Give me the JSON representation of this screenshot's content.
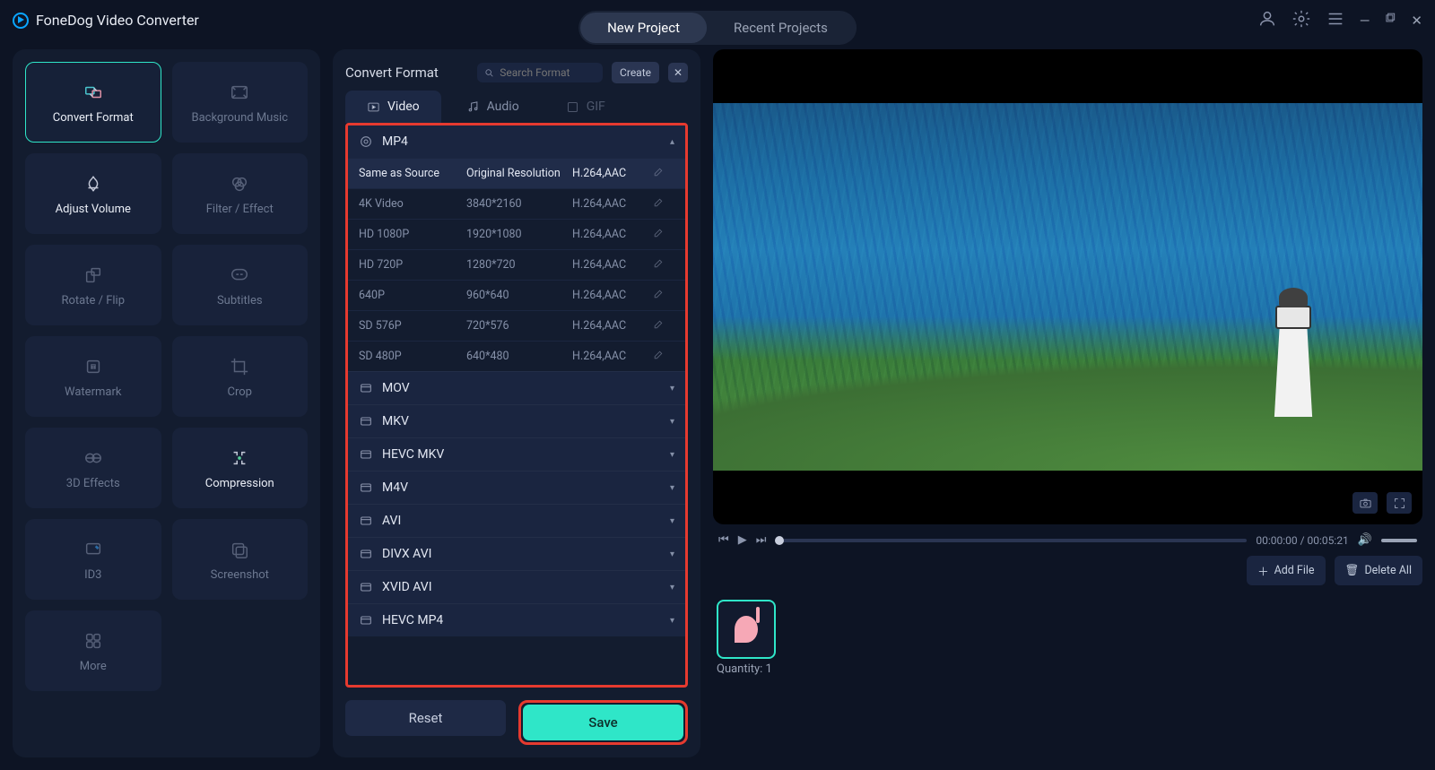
{
  "app_title": "FoneDog Video Converter",
  "tabs": {
    "new": "New Project",
    "recent": "Recent Projects"
  },
  "sidebar": {
    "tools": [
      {
        "id": "convert-format",
        "label": "Convert Format",
        "icon": "convert"
      },
      {
        "id": "background-music",
        "label": "Background Music",
        "icon": "music"
      },
      {
        "id": "adjust-volume",
        "label": "Adjust Volume",
        "icon": "volume"
      },
      {
        "id": "filter-effect",
        "label": "Filter / Effect",
        "icon": "filter"
      },
      {
        "id": "rotate-flip",
        "label": "Rotate / Flip",
        "icon": "rotate"
      },
      {
        "id": "subtitles",
        "label": "Subtitles",
        "icon": "subtitles"
      },
      {
        "id": "watermark",
        "label": "Watermark",
        "icon": "watermark"
      },
      {
        "id": "crop",
        "label": "Crop",
        "icon": "crop"
      },
      {
        "id": "3d-effects",
        "label": "3D Effects",
        "icon": "3d"
      },
      {
        "id": "compression",
        "label": "Compression",
        "icon": "compress"
      },
      {
        "id": "id3",
        "label": "ID3",
        "icon": "id3"
      },
      {
        "id": "screenshot",
        "label": "Screenshot",
        "icon": "screenshot"
      },
      {
        "id": "more",
        "label": "More",
        "icon": "more"
      }
    ]
  },
  "mid": {
    "title": "Convert Format",
    "search_placeholder": "Search Format",
    "create": "Create",
    "type_tabs": {
      "video": "Video",
      "audio": "Audio",
      "gif": "GIF"
    },
    "presets": [
      {
        "name": "Same as Source",
        "res": "Original Resolution",
        "codec": "H.264,AAC",
        "sel": true
      },
      {
        "name": "4K Video",
        "res": "3840*2160",
        "codec": "H.264,AAC"
      },
      {
        "name": "HD 1080P",
        "res": "1920*1080",
        "codec": "H.264,AAC"
      },
      {
        "name": "HD 720P",
        "res": "1280*720",
        "codec": "H.264,AAC"
      },
      {
        "name": "640P",
        "res": "960*640",
        "codec": "H.264,AAC"
      },
      {
        "name": "SD 576P",
        "res": "720*576",
        "codec": "H.264,AAC"
      },
      {
        "name": "SD 480P",
        "res": "640*480",
        "codec": "H.264,AAC"
      }
    ],
    "groups": [
      "MOV",
      "MKV",
      "HEVC MKV",
      "M4V",
      "AVI",
      "DIVX AVI",
      "XVID AVI",
      "HEVC MP4"
    ],
    "open_group": "MP4",
    "reset": "Reset",
    "save": "Save"
  },
  "player": {
    "time": "00:00:00 / 00:05:21"
  },
  "files": {
    "add": "Add File",
    "delete": "Delete All",
    "quantity_label": "Quantity: 1"
  }
}
